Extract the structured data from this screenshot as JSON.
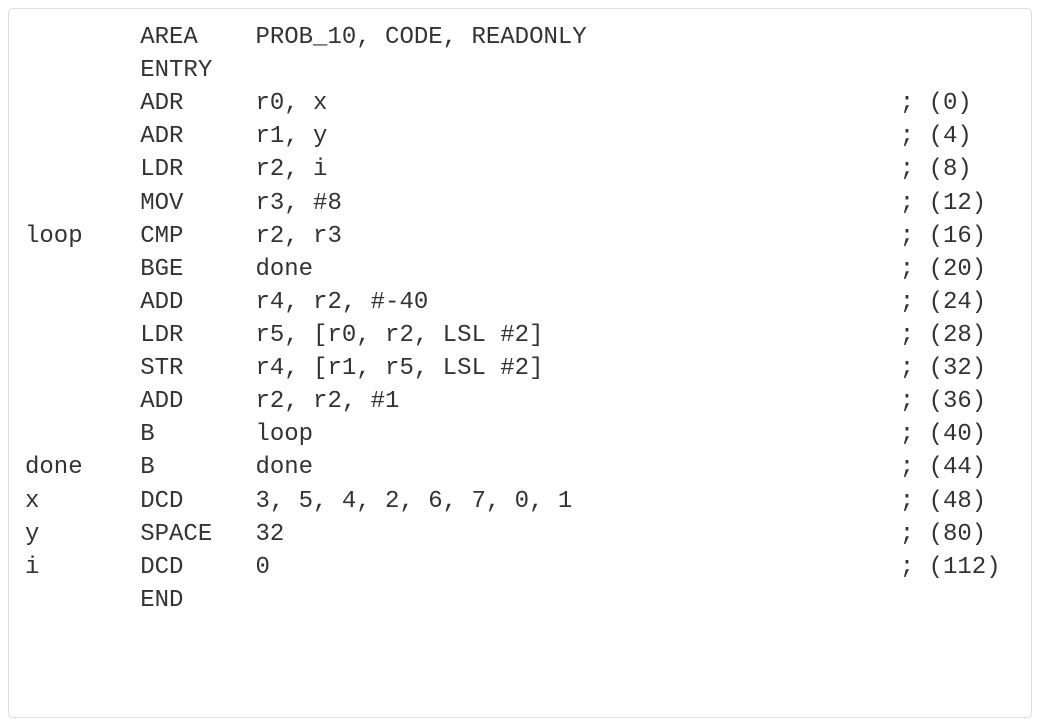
{
  "lines": [
    {
      "label": "",
      "op": "AREA",
      "args": "PROB_10, CODE, READONLY",
      "comment": ""
    },
    {
      "label": "",
      "op": "ENTRY",
      "args": "",
      "comment": ""
    },
    {
      "label": "",
      "op": "ADR",
      "args": "r0, x",
      "comment": "; (0)"
    },
    {
      "label": "",
      "op": "ADR",
      "args": "r1, y",
      "comment": "; (4)"
    },
    {
      "label": "",
      "op": "LDR",
      "args": "r2, i",
      "comment": "; (8)"
    },
    {
      "label": "",
      "op": "MOV",
      "args": "r3, #8",
      "comment": "; (12)"
    },
    {
      "label": "loop",
      "op": "CMP",
      "args": "r2, r3",
      "comment": "; (16)"
    },
    {
      "label": "",
      "op": "BGE",
      "args": "done",
      "comment": "; (20)"
    },
    {
      "label": "",
      "op": "ADD",
      "args": "r4, r2, #-40",
      "comment": "; (24)"
    },
    {
      "label": "",
      "op": "LDR",
      "args": "r5, [r0, r2, LSL #2]",
      "comment": "; (28)"
    },
    {
      "label": "",
      "op": "STR",
      "args": "r4, [r1, r5, LSL #2]",
      "comment": "; (32)"
    },
    {
      "label": "",
      "op": "ADD",
      "args": "r2, r2, #1",
      "comment": "; (36)"
    },
    {
      "label": "",
      "op": "B",
      "args": "loop",
      "comment": "; (40)"
    },
    {
      "label": "done",
      "op": "B",
      "args": "done",
      "comment": "; (44)"
    },
    {
      "label": "x",
      "op": "DCD",
      "args": "3, 5, 4, 2, 6, 7, 0, 1",
      "comment": "; (48)"
    },
    {
      "label": "y",
      "op": "SPACE",
      "args": "32",
      "comment": "; (80)"
    },
    {
      "label": "i",
      "op": "DCD",
      "args": "0",
      "comment": "; (112)"
    },
    {
      "label": "",
      "op": "END",
      "args": "",
      "comment": ""
    }
  ]
}
